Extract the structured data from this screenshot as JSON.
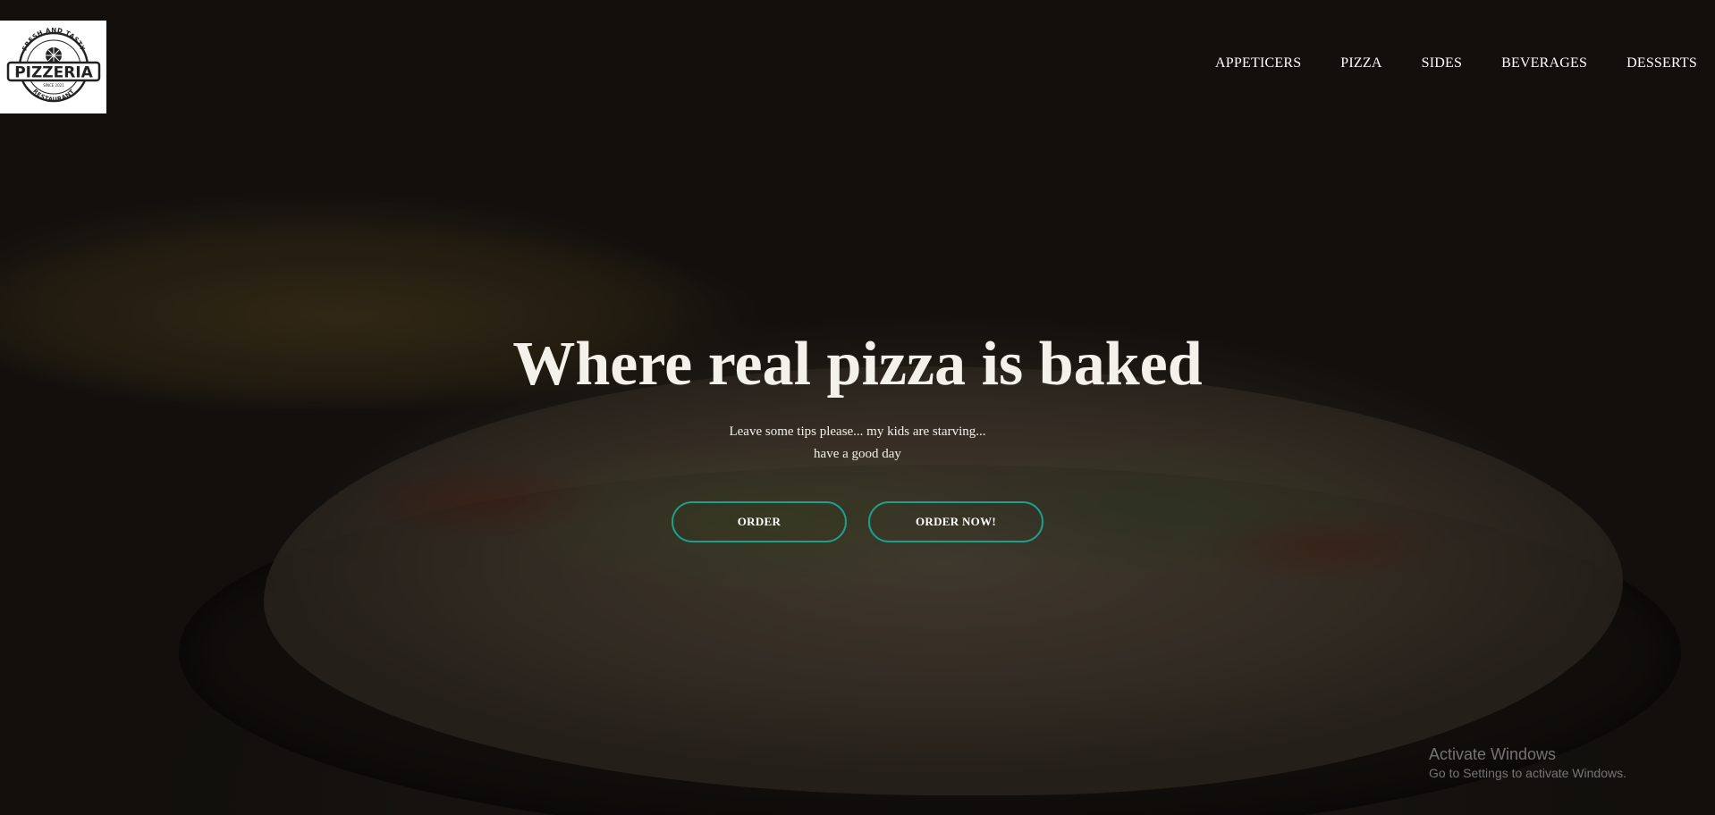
{
  "brand": {
    "logo_top_text": "FRESH AND TASTY",
    "logo_main_text": "PIZZERIA",
    "logo_mid_text": "SINCE 2021",
    "logo_bottom_text": "RESTAURANT"
  },
  "nav": {
    "items": [
      {
        "label": "APPETICERS"
      },
      {
        "label": "PIZZA"
      },
      {
        "label": "SIDES"
      },
      {
        "label": "BEVERAGES"
      },
      {
        "label": "DESSERTS"
      }
    ]
  },
  "hero": {
    "title": "Where real pizza is baked",
    "subtitle_line1": "Leave some tips please... my kids are starving...",
    "subtitle_line2": "have a good day",
    "accent_color": "#1f9e8e",
    "buttons": {
      "order_label": "ORDER",
      "order_now_label": "ORDER NOW!"
    }
  },
  "system": {
    "watermark_title": "Activate Windows",
    "watermark_text": "Go to Settings to activate Windows."
  }
}
